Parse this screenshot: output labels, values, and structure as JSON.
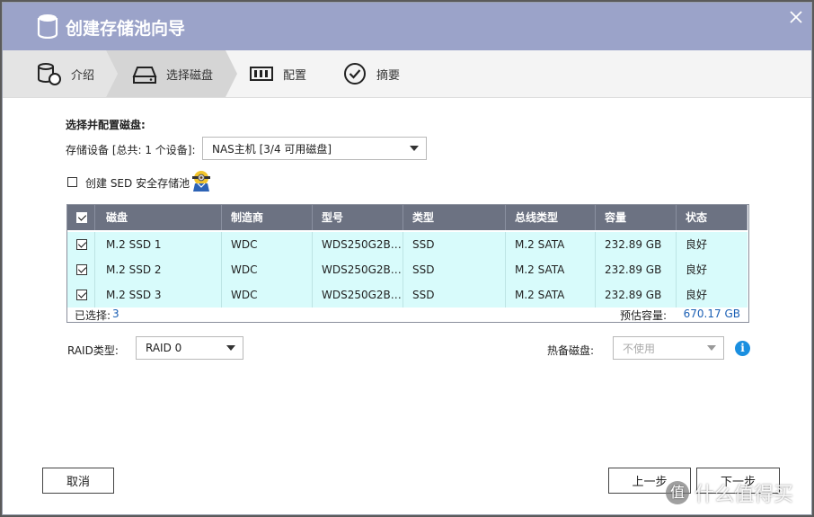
{
  "title": "创建存储池向导",
  "steps": [
    {
      "label": "介绍",
      "icon": "database-icon"
    },
    {
      "label": "选择磁盘",
      "icon": "drive-icon"
    },
    {
      "label": "配置",
      "icon": "config-icon"
    },
    {
      "label": "摘要",
      "icon": "check-circle-icon"
    }
  ],
  "active_step": 1,
  "section_title": "选择并配置磁盘:",
  "storage_device": {
    "label": "存储设备 [总共: 1 个设备]:",
    "value": "NAS主机 [3/4 可用磁盘]"
  },
  "sed": {
    "label": "创建 SED 安全存储池",
    "checked": false
  },
  "table": {
    "columns": [
      "磁盘",
      "制造商",
      "型号",
      "类型",
      "总线类型",
      "容量",
      "状态"
    ],
    "rows": [
      {
        "checked": true,
        "cells": [
          "M.2 SSD 1",
          "WDC",
          "WDS250G2B…",
          "SSD",
          "M.2 SATA",
          "232.89 GB",
          "良好"
        ]
      },
      {
        "checked": true,
        "cells": [
          "M.2 SSD 2",
          "WDC",
          "WDS250G2B…",
          "SSD",
          "M.2 SATA",
          "232.89 GB",
          "良好"
        ]
      },
      {
        "checked": true,
        "cells": [
          "M.2 SSD 3",
          "WDC",
          "WDS250G2B…",
          "SSD",
          "M.2 SATA",
          "232.89 GB",
          "良好"
        ]
      }
    ],
    "selected_label": "已选择:",
    "selected_count": "3",
    "capacity_label": "预估容量:",
    "capacity_value": "670.17 GB"
  },
  "raid": {
    "label": "RAID类型:",
    "value": "RAID 0"
  },
  "hotspare": {
    "label": "热备磁盘:",
    "value": "不使用"
  },
  "buttons": {
    "cancel": "取消",
    "prev": "上一步",
    "next": "下一步"
  },
  "watermark": {
    "badge": "值",
    "text": "什么值得买"
  },
  "colors": {
    "titlebar": "#9ba3c9",
    "table_header": "#6c7282",
    "row_bg": "#d8fbfb",
    "accent": "#1a5fb4"
  }
}
